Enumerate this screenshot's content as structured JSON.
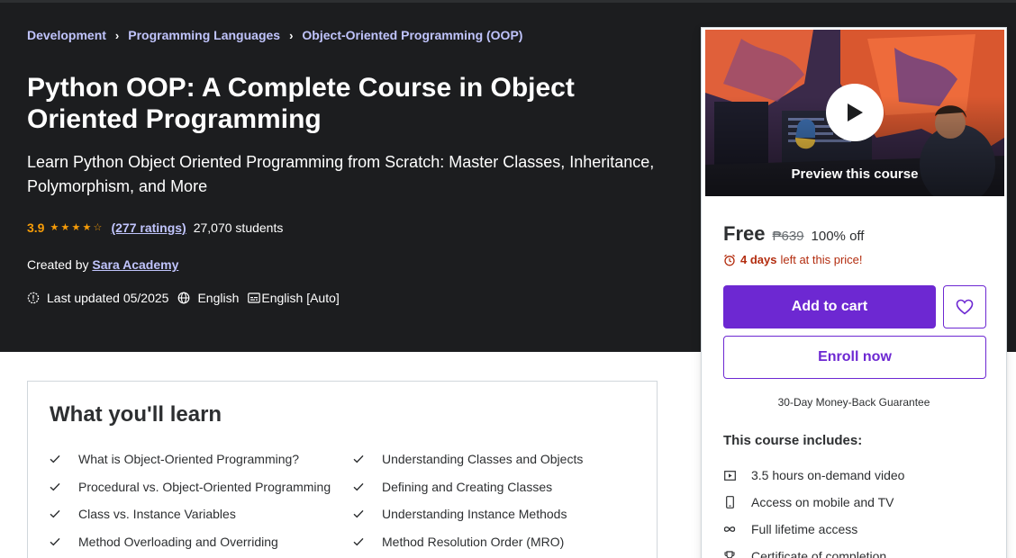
{
  "breadcrumb": [
    {
      "label": "Development"
    },
    {
      "label": "Programming Languages"
    },
    {
      "label": "Object-Oriented Programming (OOP)"
    }
  ],
  "breadcrumb_separator": "›",
  "course": {
    "title": "Python OOP: A Complete Course in Object Oriented Programming",
    "subtitle": "Learn Python Object Oriented Programming from Scratch: Master Classes, Inheritance, Polymorphism, and More",
    "rating": "3.9",
    "stars_filled_fraction": 0.78,
    "ratings_link": "(277 ratings)",
    "students": "27,070 students",
    "created_by_label": "Created by",
    "author": "Sara Academy",
    "last_updated": "Last updated 05/2025",
    "language": "English",
    "captions": "English [Auto]"
  },
  "sidebar": {
    "preview_label": "Preview this course",
    "price_now": "Free",
    "price_old": "₱639",
    "discount": "100% off",
    "countdown_bold": "4 days",
    "countdown_rest": "left at this price!",
    "add_to_cart": "Add to cart",
    "enroll_now": "Enroll now",
    "guarantee": "30-Day Money-Back Guarantee",
    "includes_title": "This course includes:",
    "includes": [
      {
        "icon": "video-icon",
        "label": "3.5 hours on-demand video"
      },
      {
        "icon": "mobile-icon",
        "label": "Access on mobile and TV"
      },
      {
        "icon": "infinity-icon",
        "label": "Full lifetime access"
      },
      {
        "icon": "trophy-icon",
        "label": "Certificate of completion"
      }
    ]
  },
  "learn": {
    "title": "What you'll learn",
    "items": [
      "What is Object-Oriented Programming?",
      "Understanding Classes and Objects",
      "Procedural vs. Object-Oriented Programming",
      "Defining and Creating Classes",
      "Class vs. Instance Variables",
      "Understanding Instance Methods",
      "Method Overloading and Overriding",
      "Method Resolution Order (MRO)"
    ]
  },
  "colors": {
    "hero_bg": "#1c1d1f",
    "link_purple": "#c0c4fc",
    "star_orange": "#f69c08",
    "brand_purple": "#6d28d2",
    "urgency_red": "#b32d0f"
  }
}
